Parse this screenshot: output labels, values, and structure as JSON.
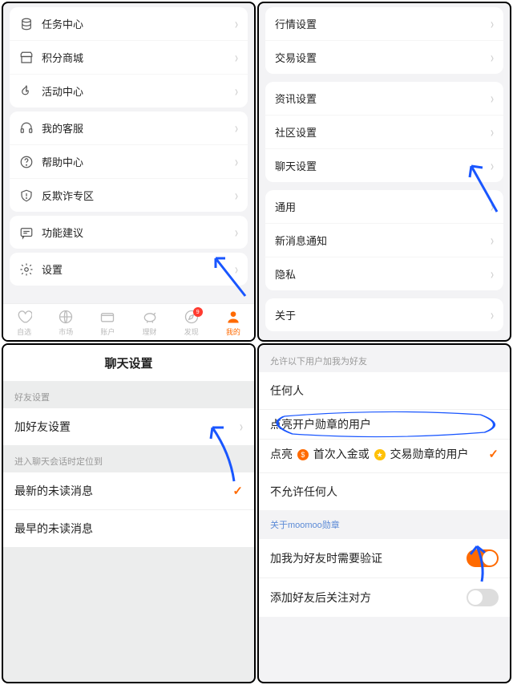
{
  "panel1": {
    "group1": [
      {
        "icon": "stack",
        "label": "任务中心"
      },
      {
        "icon": "store",
        "label": "积分商城"
      },
      {
        "icon": "flame",
        "label": "活动中心"
      }
    ],
    "group2": [
      {
        "icon": "headset",
        "label": "我的客服"
      },
      {
        "icon": "help",
        "label": "帮助中心"
      },
      {
        "icon": "shield",
        "label": "反欺诈专区"
      }
    ],
    "group3": [
      {
        "icon": "feedback",
        "label": "功能建议"
      }
    ],
    "group4": [
      {
        "icon": "gear",
        "label": "设置"
      }
    ],
    "tabs": [
      {
        "icon": "heart",
        "label": "自选"
      },
      {
        "icon": "globe",
        "label": "市场"
      },
      {
        "icon": "wallet",
        "label": "账户"
      },
      {
        "icon": "piggy",
        "label": "理财"
      },
      {
        "icon": "compass",
        "label": "发现",
        "badge": "9"
      },
      {
        "icon": "person",
        "label": "我的",
        "active": true
      }
    ]
  },
  "panel2": {
    "groups": [
      [
        "行情设置",
        "交易设置"
      ],
      [
        "资讯设置",
        "社区设置",
        "聊天设置"
      ],
      [
        "通用",
        "新消息通知",
        "隐私"
      ],
      [
        "关于"
      ]
    ]
  },
  "panel3": {
    "title": "聊天设置",
    "sec1_label": "好友设置",
    "sec1_item": "加好友设置",
    "sec2_label": "进入聊天会话时定位到",
    "sec2_items": [
      {
        "label": "最新的未读消息",
        "checked": true
      },
      {
        "label": "最早的未读消息",
        "checked": false
      }
    ]
  },
  "panel4": {
    "header": "允许以下用户加我为好友",
    "rows": [
      {
        "label": "任何人"
      },
      {
        "label": "点亮开户勋章的用户",
        "circled": true
      },
      {
        "label_parts": [
          "点亮 ",
          " 首次入金或 ",
          " 交易勋章的用户"
        ],
        "icons": [
          "orange",
          "gold"
        ],
        "checked": true,
        "circled": true
      },
      {
        "label": "不允许任何人"
      }
    ],
    "link": "关于moomoo勋章",
    "toggles": [
      {
        "label": "加我为好友时需要验证",
        "on": true
      },
      {
        "label": "添加好友后关注对方",
        "on": false
      }
    ]
  }
}
